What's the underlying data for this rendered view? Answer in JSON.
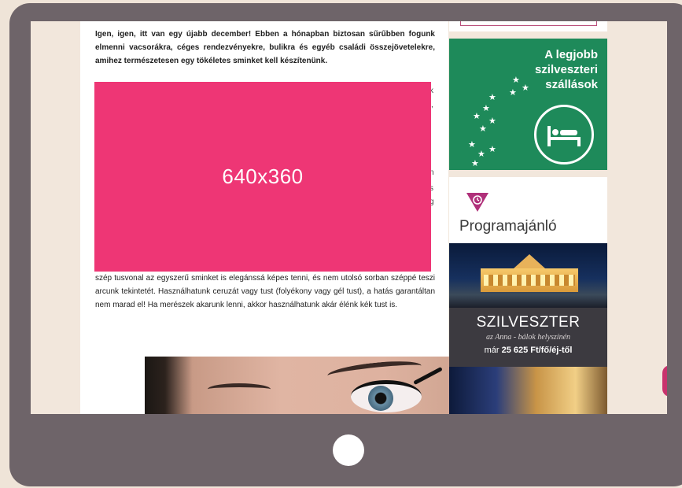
{
  "article": {
    "intro": "Igen, igen, itt van egy újabb december! Ebben a hónapban biztosan sűrűbben fogunk elmenni vacsorákra, céges rendezvényekre, bulikra és egyéb családi összejövetelekre, amihez természetesen egy tökéletes sminket kell készítenünk.",
    "placeholder_label": "640x360",
    "body": "szép tusvonal az egyszerű sminket is elegánssá képes tenni, és nem utolsó sorban széppé teszi arcunk tekintetét. Használhatunk ceruzát vagy tust (folyékony vagy gél tust), a hatás garantáltan nem marad el! Ha merészek akarunk lenni, akkor használhatunk akár élénk kék tust is.",
    "hidden_chars": [
      "k",
      ",",
      "n",
      "s",
      "g"
    ]
  },
  "sidebar": {
    "ad_lines": [
      "A legjobb",
      "szilveszteri",
      "szállások"
    ],
    "ad_icon": "bed-icon",
    "ad_color": "#1e8a5a",
    "section_icon": "clock-icon",
    "section_color": "#b0307a",
    "section_title": "Programajánló",
    "banner_title": "SZILVESZTER",
    "banner_subtitle": "az Anna - bálok helyszínén",
    "banner_price_prefix": "már",
    "banner_price_value": "25 625 Ft/fő/éj-től"
  },
  "device": {
    "frame_color": "#6e6469",
    "home_button": "home-button"
  },
  "colors": {
    "placeholder": "#ee3675",
    "background": "#efe4d8"
  }
}
